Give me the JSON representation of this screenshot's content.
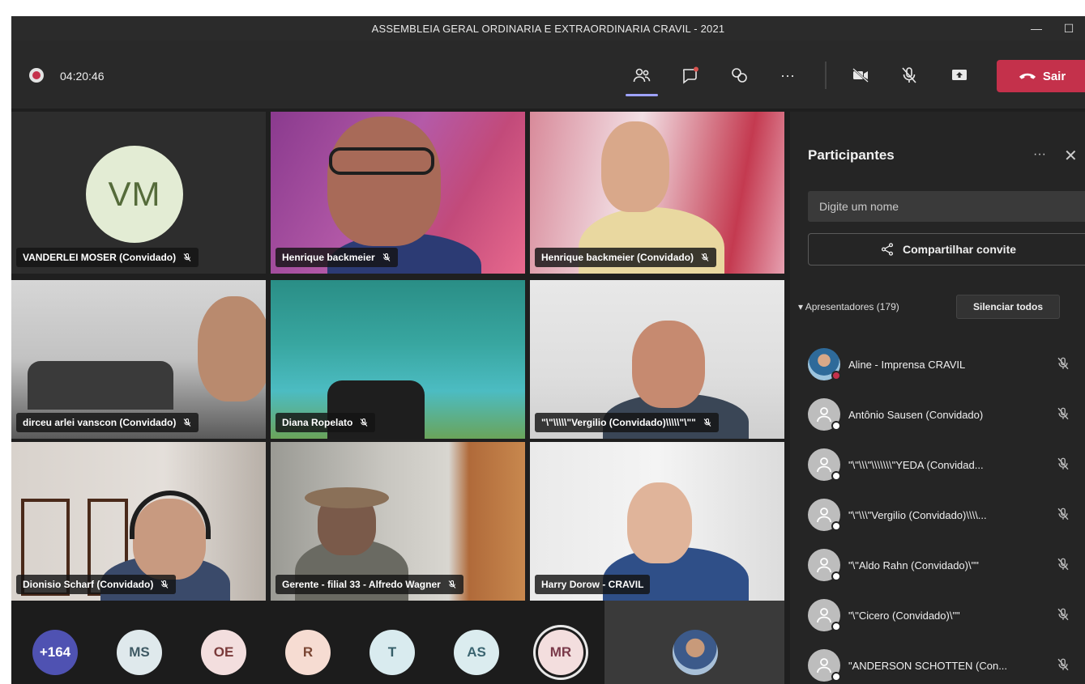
{
  "window": {
    "title": "ASSEMBLEIA GERAL ORDINARIA E EXTRAORDINARIA CRAVIL - 2021"
  },
  "toolbar": {
    "timer": "04:20:46",
    "leave_label": "Sair",
    "icons": [
      "people-icon",
      "chat-icon",
      "reactions-icon",
      "more-icon",
      "camera-off-icon",
      "mic-off-icon",
      "share-screen-icon",
      "phone-icon"
    ]
  },
  "grid": {
    "tiles": [
      {
        "name": "VANDERLEI MOSER (Convidado)",
        "initials": "VM"
      },
      {
        "name": "Henrique backmeier"
      },
      {
        "name": "Henrique backmeier (Convidado)"
      },
      {
        "name": "dirceu arlei vanscon (Convidado)"
      },
      {
        "name": "Diana Ropelato"
      },
      {
        "name": "\"\\\"\\\\\\\\\\\"Vergilio (Convidado)\\\\\\\\\\\"\\\"\""
      },
      {
        "name": "Dionisio Scharf (Convidado)"
      },
      {
        "name": "Gerente - filial 33 - Alfredo Wagner"
      },
      {
        "name": "Harry Dorow - CRAVIL"
      }
    ]
  },
  "panel": {
    "title": "Participantes",
    "more": "···",
    "close": "✕",
    "search_placeholder": "Digite um nome",
    "share_label": "Compartilhar convite",
    "presenters_label": "Apresentadores (179)",
    "mute_all_label": "Silenciar todos",
    "participants": [
      "Aline - Imprensa CRAVIL",
      "Antônio Sausen (Convidado)",
      "\"\\\"\\\\\\\"\\\\\\\\\\\\\\\"YEDA (Convidad...",
      "\"\\\"\\\\\\\"Vergilio (Convidado)\\\\\\\\...",
      "\"\\\"Aldo Rahn (Convidado)\\\"\"",
      "\"\\\"Cicero (Convidado)\\\"\"",
      "\"ANDERSON SCHOTTEN (Con..."
    ]
  },
  "strip": {
    "avatars": [
      {
        "label": "+164",
        "bg": "#4f52b2",
        "fg": "#ffffff"
      },
      {
        "label": "MS",
        "bg": "#dfe9ec",
        "fg": "#3f5a64"
      },
      {
        "label": "OE",
        "bg": "#f3dede",
        "fg": "#7a3a3a"
      },
      {
        "label": "R",
        "bg": "#f6dcd2",
        "fg": "#7a4634"
      },
      {
        "label": "T",
        "bg": "#d9ebef",
        "fg": "#355e68"
      },
      {
        "label": "AS",
        "bg": "#dbecef",
        "fg": "#3a6470"
      },
      {
        "label": "MR",
        "bg": "#f3dede",
        "fg": "#7a3a4a"
      }
    ]
  },
  "colors": {
    "accent": "#9ea2ff",
    "leave": "#c4314b",
    "panel_bg": "#252525",
    "toolbar_bg": "#292929"
  }
}
